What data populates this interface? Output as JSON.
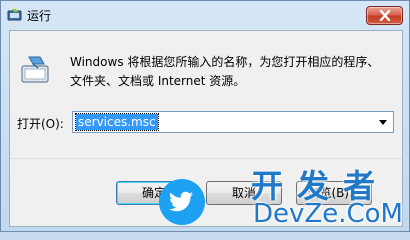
{
  "window": {
    "title": "运行",
    "close_icon": "close-icon"
  },
  "dialog": {
    "description": "Windows 将根据您所输入的名称，为您打开相应的程序、文件夹、文档或 Internet 资源。",
    "open_label": "打开(O):",
    "command_value": "services.msc"
  },
  "buttons": {
    "ok": "确定",
    "cancel": "取消",
    "browse": "浏览(B)..."
  },
  "watermark": {
    "chinese": "开发者",
    "english": "DevZe.CoM"
  },
  "colors": {
    "titlebar": "#c3d8ee",
    "selection": "#3399ff",
    "close_button": "#c43b24",
    "watermark_blue": "#1f78c8",
    "twitter_blue": "#1da1f2"
  }
}
